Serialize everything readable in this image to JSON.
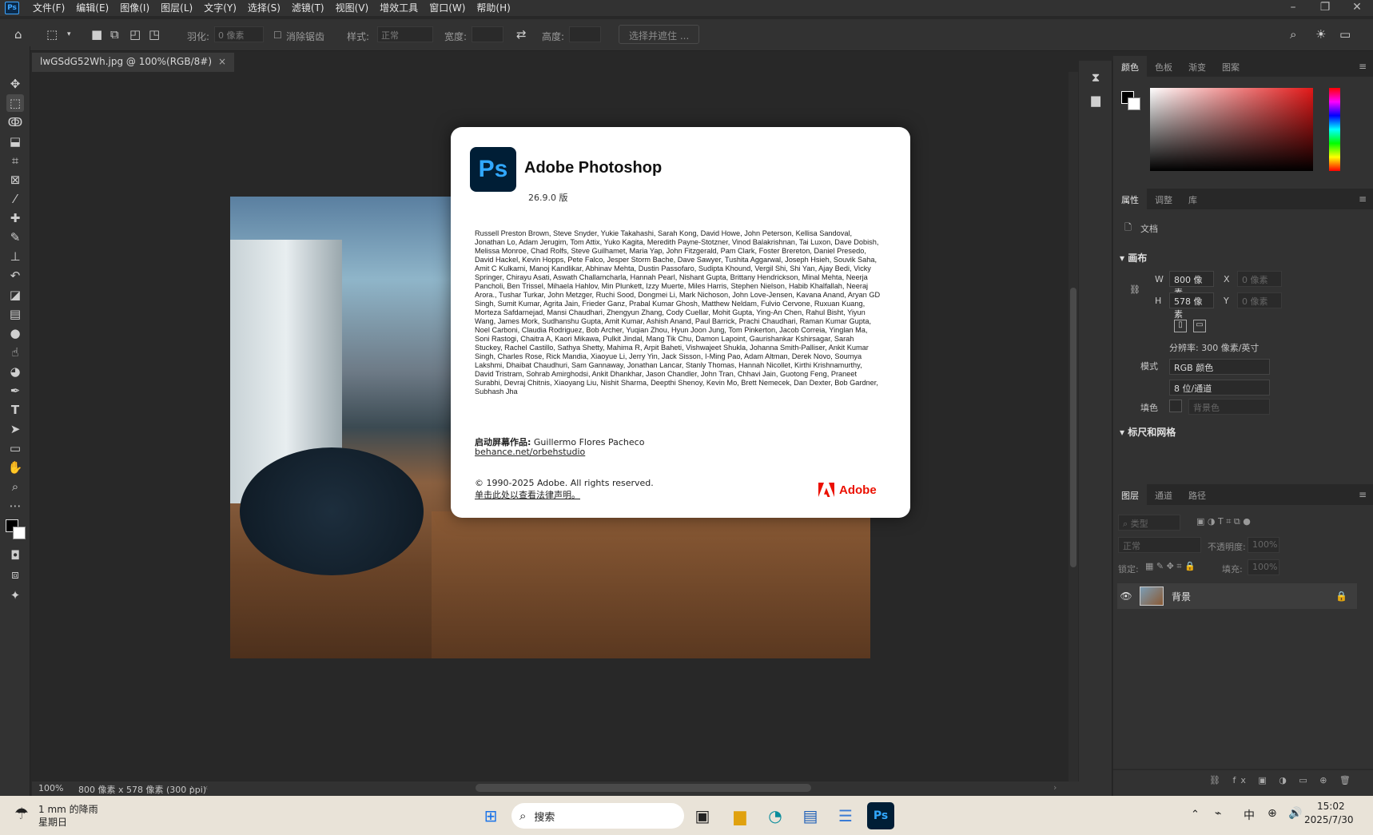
{
  "menubar": {
    "items": [
      "文件(F)",
      "编辑(E)",
      "图像(I)",
      "图层(L)",
      "文字(Y)",
      "选择(S)",
      "滤镜(T)",
      "视图(V)",
      "增效工具",
      "窗口(W)",
      "帮助(H)"
    ],
    "app_icon": "Ps"
  },
  "options": {
    "feather_label": "羽化:",
    "feather_value": "0 像素",
    "antialias_label": "消除锯齿",
    "style_label": "样式:",
    "style_value": "正常",
    "width_label": "宽度:",
    "height_label": "高度:",
    "select_mask_label": "选择并遮住 ..."
  },
  "document": {
    "tab_title": "lwGSdG52Wh.jpg @ 100%(RGB/8#)",
    "close": "×"
  },
  "status": {
    "zoom": "100%",
    "info": "800 像素 x 578 像素 (300 ppi)"
  },
  "about": {
    "logo": "Ps",
    "title": "Adobe Photoshop",
    "version": "26.9.0 版",
    "credits": "Russell Preston Brown, Steve Snyder, Yukie Takahashi, Sarah Kong, David Howe, John Peterson, Kellisa Sandoval, Jonathan Lo, Adam Jerugim, Tom Attix, Yuko Kagita, Meredith Payne-Stotzner, Vinod Balakrishnan, Tai Luxon, Dave Dobish, Melissa Monroe, Chad Rolfs, Steve Guilhamet, Maria Yap, John Fitzgerald, Pam Clark, Foster Brereton, Daniel Presedo, David Hackel, Kevin Hopps, Pete Falco, Jesper Storm Bache, Dave Sawyer, Tushita Aggarwal, Joseph Hsieh, Souvik Saha, Amit C Kulkarni, Manoj Kandlikar, Abhinav Mehta, Dustin Passofaro, Sudipta Khound, Vergil Shi, Shi Yan, Ajay Bedi, Vicky Springer, Chirayu Asati, Aswath Challamcharla, Hannah Pearl, Nishant Gupta, Brittany Hendrickson, Minal Mehta, Neerja Pancholi, Ben Trissel, Mihaela Hahlov, Min Plunkett, Izzy Muerte, Miles Harris, Stephen Nielson, Habib Khalfallah, Neeraj Arora., Tushar Turkar, John Metzger, Ruchi Sood, Dongmei Li, Mark Nichoson, John Love-Jensen, Kavana Anand, Aryan GD Singh, Sumit Kumar, Agrita Jain, Frieder Ganz, Prabal Kumar Ghosh, Matthew Neldam, Fulvio Cervone, Ruxuan Kuang, Morteza Safdarnejad, Mansi Chaudhari, Zhengyun Zhang, Cody Cuellar, Mohit Gupta, Ying-An Chen, Rahul Bisht, Yiyun Wang, James Mork, Sudhanshu Gupta, Amit Kumar, Ashish Anand, Paul Barrick, Prachi Chaudhari, Raman Kumar Gupta, Noel Carboni, Claudia Rodriguez, Bob Archer, Yuqian Zhou, Hyun Joon Jung, Tom Pinkerton, Jacob Correia, Yinglan Ma, Soni Rastogi, Chaitra A, Kaori Mikawa, Pulkit Jindal, Mang Tik Chu, Damon Lapoint, Gaurishankar Kshirsagar, Sarah Stuckey, Rachel Castillo, Sathya Shetty, Mahima R, Arpit Baheti, Vishwajeet Shukla, Johanna Smith-Palliser, Ankit Kumar Singh, Charles Rose, Rick Mandia, Xiaoyue Li, Jerry Yin, Jack Sisson, I-Ming Pao, Adam Altman, Derek Novo, Soumya Lakshmi, Dhaibat Chaudhuri, Sam Gannaway, Jonathan Lancar, Stanly Thomas, Hannah Nicollet, Kirthi Krishnamurthy, David Tristram, Sohrab Amirghodsi, Ankit Dhankhar, Jason Chandler, John Tran, Chhavi Jain, Guotong Feng, Praneet Surabhi, Devraj Chitnis, Xiaoyang Liu, Nishit Sharma, Deepthi Shenoy, Kevin Mo, Brett Nemecek, Dan Dexter, Bob Gardner, Subhash Jha",
    "splash_label": "启动屏幕作品:",
    "splash_artist": "Guillermo Flores Pacheco",
    "splash_link": "behance.net/orbehstudio",
    "copyright": "© 1990-2025 Adobe. All rights reserved.",
    "legal_link": "单击此处以查看法律声明。",
    "adobe_brand": "Adobe"
  },
  "panels": {
    "color_tabs": [
      "颜色",
      "色板",
      "渐变",
      "图案"
    ],
    "prop_tabs": [
      "属性",
      "调整",
      "库"
    ],
    "doc_label": "文档",
    "canvas_section": "画布",
    "w_label": "W",
    "w_value": "800 像素",
    "h_label": "H",
    "h_value": "578 像素",
    "x_label": "X",
    "x_value": "0 像素",
    "y_label": "Y",
    "y_value": "0 像素",
    "resolution": "分辨率: 300 像素/英寸",
    "mode_label": "模式",
    "mode_value": "RGB 颜色",
    "depth_value": "8 位/通道",
    "fill_label": "填色",
    "fill_value": "背景色",
    "rulers_section": "标尺和网格",
    "layer_tabs": [
      "图层",
      "通道",
      "路径"
    ],
    "kind_placeholder": "类型",
    "blend_value": "正常",
    "opacity_label": "不透明度:",
    "opacity_value": "100%",
    "lock_label": "锁定:",
    "fill2_label": "填充:",
    "fill2_value": "100%",
    "layer_name": "背景"
  },
  "taskbar": {
    "weather_temp": "1 mm 的降雨",
    "weather_day": "星期日",
    "search_label": "搜索",
    "ime": "中",
    "time": "15:02",
    "date": "2025/7/30"
  },
  "colors": {
    "ps_blue": "#31a8ff",
    "ps_navy": "#001e36",
    "adobe_red": "#eb1000"
  }
}
